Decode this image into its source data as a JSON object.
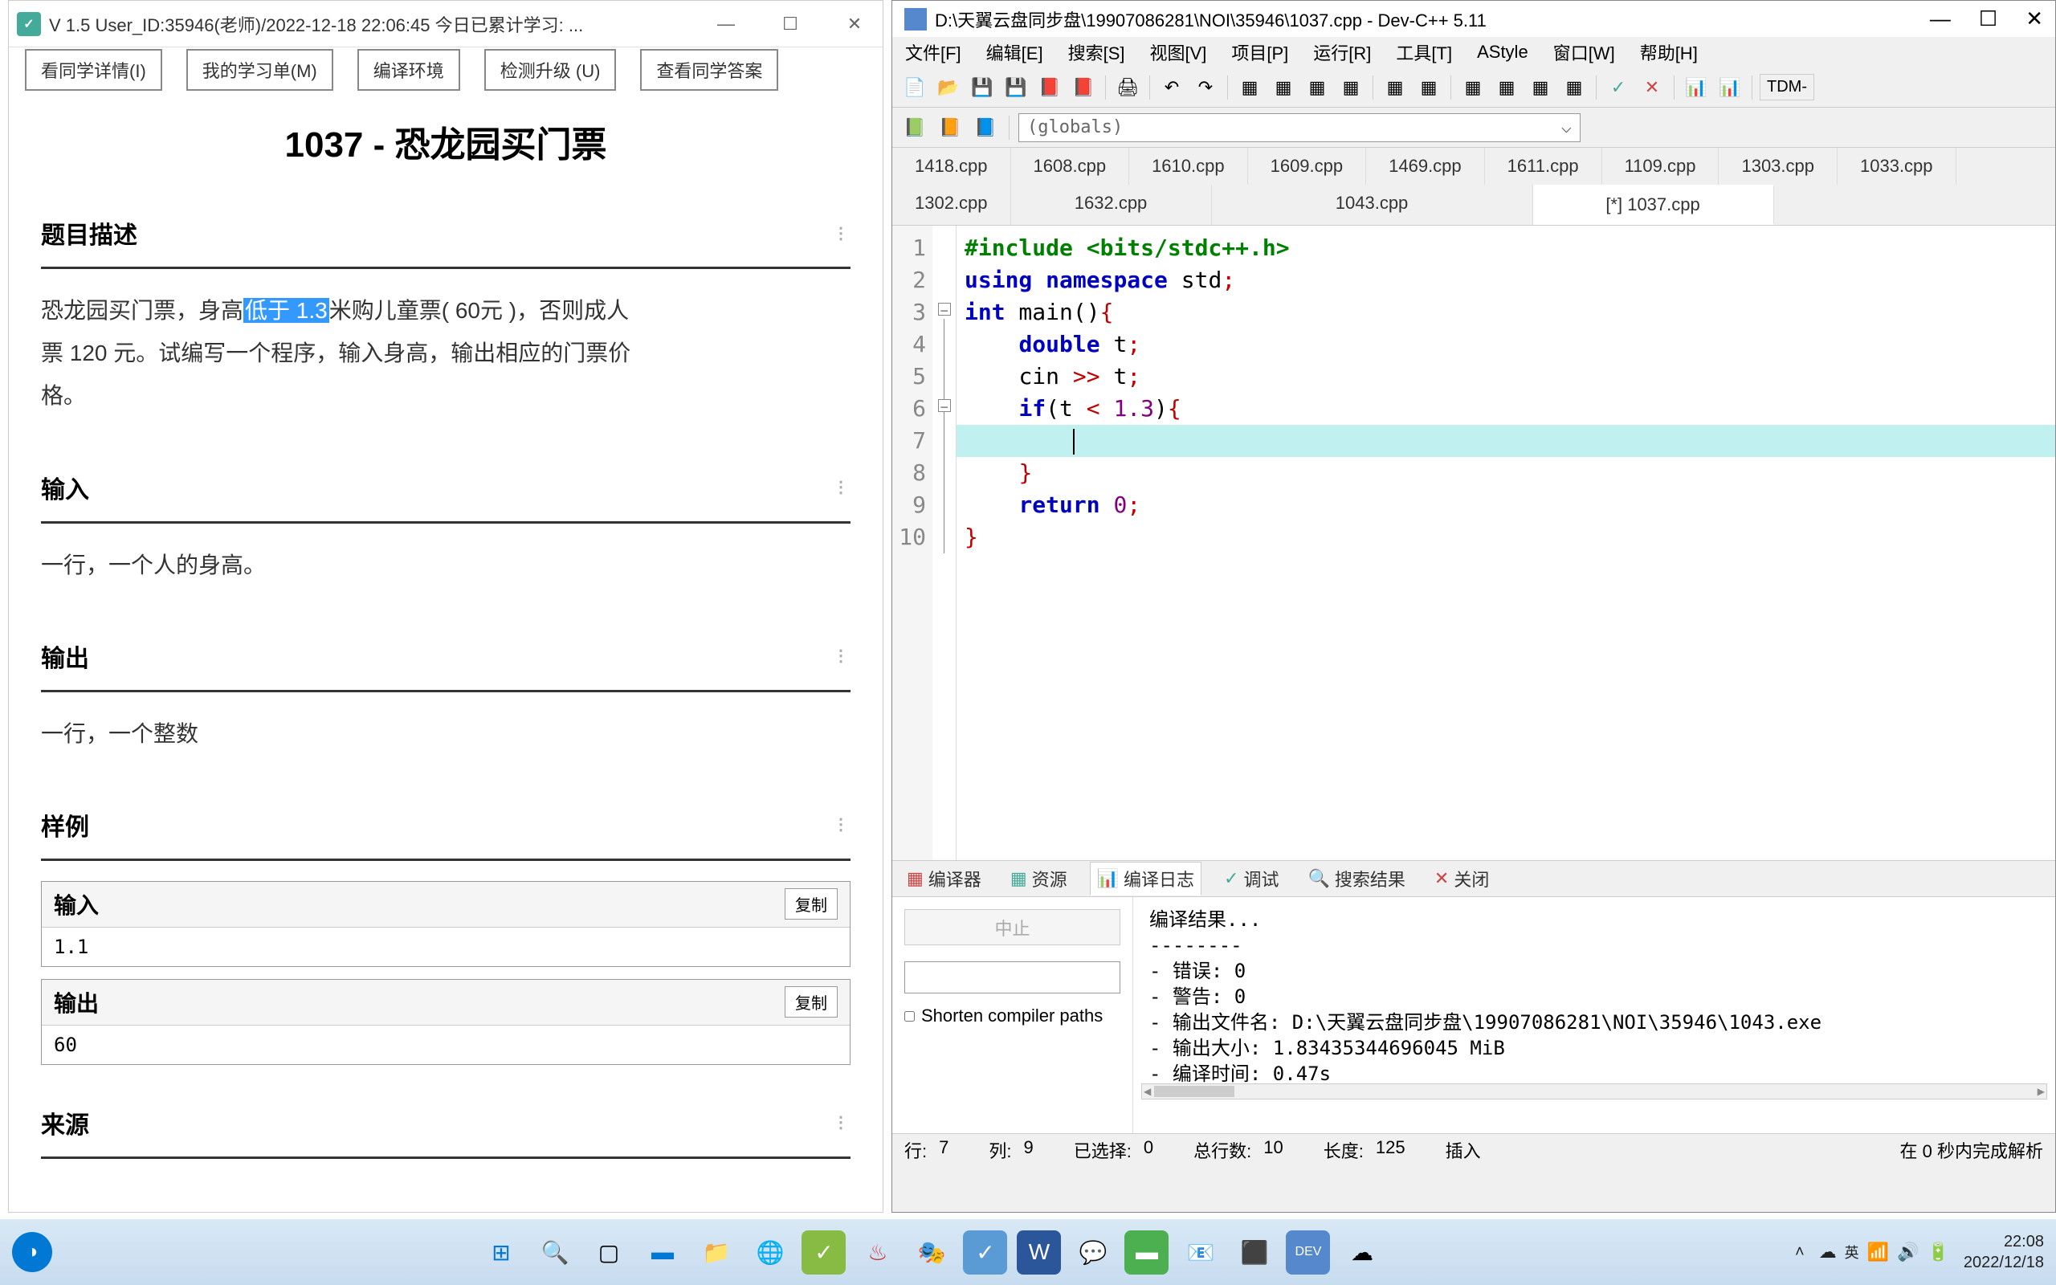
{
  "left_window": {
    "title": "V 1.5 User_ID:35946(老师)/2022-12-18 22:06:45 今日已累计学习: ...",
    "toolbar": {
      "view_detail": "看同学详情(I)",
      "study_list": "我的学习单(M)",
      "compile_env": "编译环境",
      "check_upgrade": "检测升级 (U)",
      "view_answers": "查看同学答案"
    },
    "problem_title": "1037 - 恐龙园买门票",
    "sections": {
      "desc_header": "题目描述",
      "desc_body_pre": "恐龙园买门票，身高",
      "desc_highlight": "低于 1.3",
      "desc_body_post1": "米购儿童票( 60元 )，否则成人",
      "desc_body_post2": "票 120 元。试编写一个程序，输入身高，输出相应的门票价",
      "desc_body_post3": "格。",
      "input_header": "输入",
      "input_body": "一行，一个人的身高。",
      "output_header": "输出",
      "output_body": "一行，一个整数",
      "sample_header": "样例",
      "sample_input_label": "输入",
      "sample_input_value": "1.1",
      "sample_output_label": "输出",
      "sample_output_value": "60",
      "copy_label": "复制",
      "source_header": "来源"
    }
  },
  "right_window": {
    "title": "D:\\天翼云盘同步盘\\19907086281\\NOI\\35946\\1037.cpp - Dev-C++ 5.11",
    "menubar": {
      "file": "文件[F]",
      "edit": "编辑[E]",
      "search": "搜索[S]",
      "view": "视图[V]",
      "project": "项目[P]",
      "run": "运行[R]",
      "tools": "工具[T]",
      "astyle": "AStyle",
      "window": "窗口[W]",
      "help": "帮助[H]"
    },
    "toolbar_tdm": "TDM-",
    "globals": "(globals)",
    "tabs": [
      "1418.cpp",
      "1608.cpp",
      "1610.cpp",
      "1609.cpp",
      "1469.cpp",
      "1611.cpp",
      "1109.cpp",
      "1303.cpp",
      "1033.cpp",
      "1302.cpp",
      "1632.cpp",
      "1043.cpp",
      "[*] 1037.cpp"
    ],
    "code": {
      "lines": [
        "1",
        "2",
        "3",
        "4",
        "5",
        "6",
        "7",
        "8",
        "9",
        "10"
      ],
      "l1_include": "#include",
      "l1_header": " <bits/stdc++.h>",
      "l2_using": "using",
      "l2_namespace": " namespace",
      "l2_std": " std",
      "l3_int": "int",
      "l3_main": " main",
      "l4_double": "double",
      "l4_t": " t",
      "l5_cin": "cin ",
      "l5_op": ">>",
      "l5_t": " t",
      "l6_if": "if",
      "l6_t": "t ",
      "l6_op": "<",
      "l6_num": " 1.3",
      "l9_return": "return",
      "l9_zero": " 0"
    },
    "bottom_tabs": {
      "compiler": "编译器",
      "resource": "资源",
      "compile_log": "编译日志",
      "debug": "调试",
      "search_result": "搜索结果",
      "close": "关闭"
    },
    "compile_panel": {
      "stop": "中止",
      "shorten": "Shorten compiler paths",
      "result_header": "编译结果...",
      "sep": "--------",
      "errors": "- 错误: 0",
      "warnings": "- 警告: 0",
      "output_file": "- 输出文件名: D:\\天翼云盘同步盘\\19907086281\\NOI\\35946\\1043.exe",
      "output_size": "- 输出大小: 1.83435344696045 MiB",
      "compile_time": "- 编译时间: 0.47s"
    },
    "statusbar": {
      "row_label": "行:",
      "row": "7",
      "col_label": "列:",
      "col": "9",
      "sel_label": "已选择:",
      "sel": "0",
      "total_label": "总行数:",
      "total": "10",
      "len_label": "长度:",
      "len": "125",
      "mode": "插入",
      "parse": "在 0 秒内完成解析"
    }
  },
  "taskbar": {
    "time": "22:08",
    "date": "2022/12/18"
  }
}
